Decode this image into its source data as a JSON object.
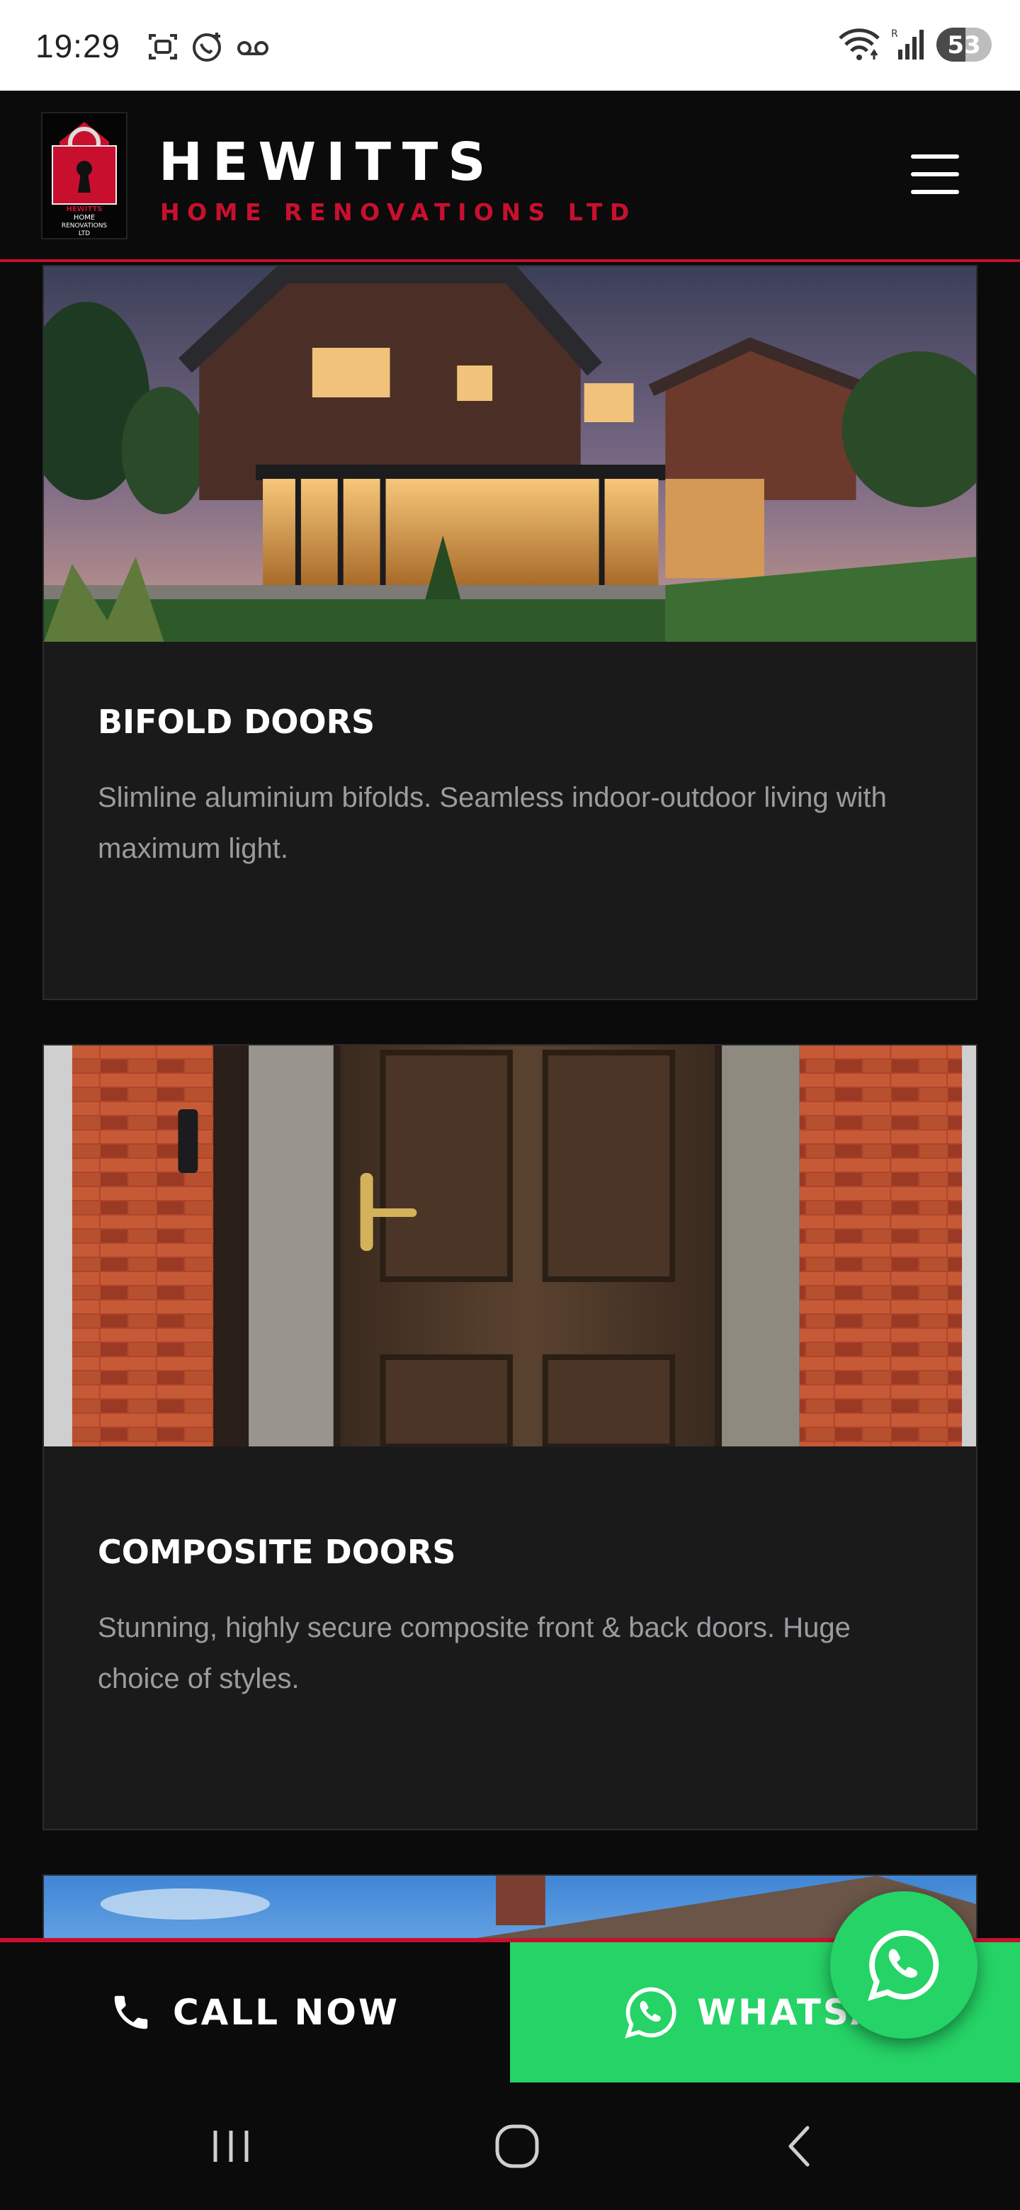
{
  "status_bar": {
    "time": "19:29",
    "battery_level": "53",
    "left_icons": [
      "screenshot-icon",
      "whatsapp-call-icon",
      "voicemail-icon"
    ],
    "right_icons": [
      "wifi-icon",
      "signal-icon",
      "battery-icon"
    ]
  },
  "header": {
    "brand_name": "HEWITTS",
    "brand_sub": "HOME RENOVATIONS LTD",
    "logo_lines": [
      "HEWITTS",
      "HOME",
      "RENOVATIONS",
      "LTD"
    ],
    "menu_icon": "hamburger-menu-icon"
  },
  "cards": [
    {
      "title": "BIFOLD DOORS",
      "description": "Slimline aluminium bifolds. Seamless indoor-outdoor living with maximum light."
    },
    {
      "title": "COMPOSITE DOORS",
      "description": "Stunning, highly secure composite front & back doors. Huge choice of styles."
    }
  ],
  "action_bar": {
    "call_label": "CALL NOW",
    "whatsapp_label": "WHATSAPP"
  },
  "colors": {
    "accent_red": "#c8102e",
    "whatsapp_green": "#25d366",
    "background": "#0b0b0b",
    "card_bg": "#1a1a1b"
  },
  "nav_bar": {
    "icons": [
      "recent-apps-icon",
      "home-icon",
      "back-icon"
    ]
  }
}
